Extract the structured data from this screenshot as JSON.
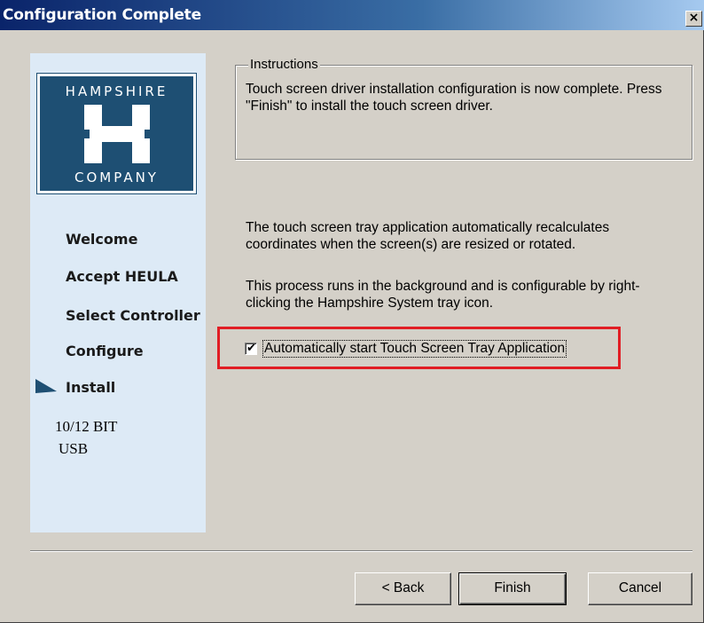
{
  "window": {
    "title": "Configuration Complete",
    "close_glyph": "×"
  },
  "sidebar": {
    "logo": {
      "top_text": "HAMPSHIRE",
      "bottom_text": "COMPANY",
      "color": "#1e4f73"
    },
    "items": [
      {
        "label": "Welcome"
      },
      {
        "label": "Accept HEULA"
      },
      {
        "label": "Select Controller"
      },
      {
        "label": "Configure"
      },
      {
        "label": "Install",
        "current": true
      }
    ],
    "info": [
      "10/12 BIT",
      "USB"
    ]
  },
  "instructions": {
    "legend": "Instructions",
    "text": "Touch screen driver installation configuration is now complete.  Press \"Finish\" to install the touch screen driver."
  },
  "body": {
    "para1": "The touch screen tray application automatically recalculates coordinates when the screen(s) are resized or rotated.",
    "para2": "This process runs in the background and is configurable by right-clicking the Hampshire System tray icon."
  },
  "checkbox": {
    "label": "Automatically start Touch Screen Tray Application",
    "checked": true,
    "check_glyph": "✔"
  },
  "buttons": {
    "back": "< Back",
    "finish": "Finish",
    "cancel": "Cancel"
  },
  "colors": {
    "highlight": "#e11d24",
    "sidebar_bg": "#ddeaf6",
    "titlebar": "#0a246a"
  }
}
